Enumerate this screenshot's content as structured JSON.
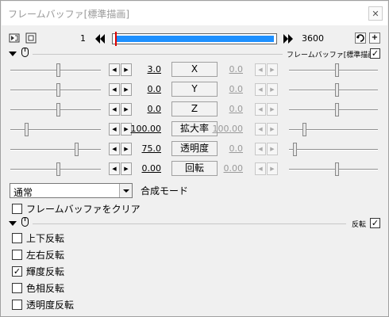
{
  "window": {
    "title": "フレームバッファ[標準描画]",
    "close": "✕"
  },
  "top": {
    "frame_start": "1",
    "frame_end": "3600",
    "plus": "+"
  },
  "section1": {
    "label": "フレームバッファ[標準描画]",
    "checked": "✓"
  },
  "params": [
    {
      "value": "3.0",
      "name": "X",
      "end_value": "0.0"
    },
    {
      "value": "0.0",
      "name": "Y",
      "end_value": "0.0"
    },
    {
      "value": "0.0",
      "name": "Z",
      "end_value": "0.0"
    },
    {
      "value": "100.00",
      "name": "拡大率",
      "end_value": "100.00"
    },
    {
      "value": "75.0",
      "name": "透明度",
      "end_value": "0.0"
    },
    {
      "value": "0.00",
      "name": "回転",
      "end_value": "0.00"
    }
  ],
  "blend": {
    "selected": "通常",
    "label": "合成モード"
  },
  "clear_buffer": {
    "label": "フレームバッファをクリア",
    "checked": ""
  },
  "section2": {
    "label": "反転",
    "checked": "✓"
  },
  "flip_options": [
    {
      "label": "上下反転",
      "checked": ""
    },
    {
      "label": "左右反転",
      "checked": ""
    },
    {
      "label": "輝度反転",
      "checked": "✓"
    },
    {
      "label": "色相反転",
      "checked": ""
    },
    {
      "label": "透明度反転",
      "checked": ""
    }
  ],
  "arrows": {
    "left": "◀",
    "right": "▶"
  }
}
